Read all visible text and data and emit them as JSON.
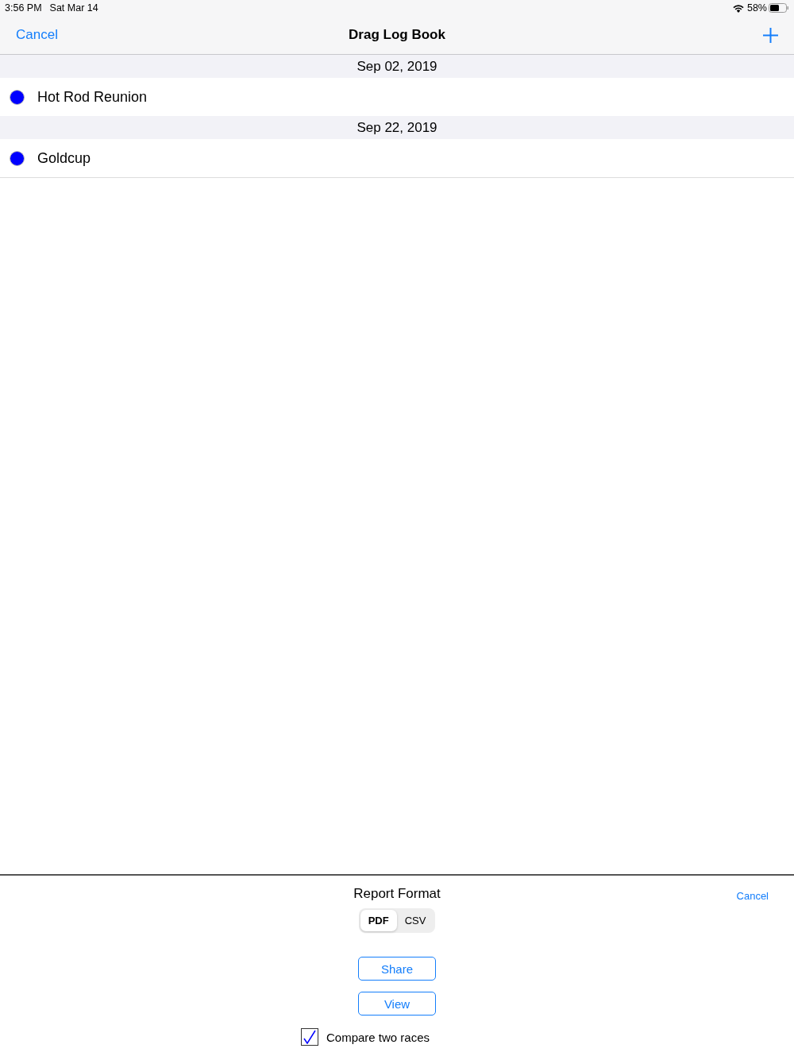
{
  "status_bar": {
    "time": "3:56 PM",
    "date": "Sat Mar 14",
    "battery": "58%"
  },
  "nav": {
    "cancel": "Cancel",
    "title": "Drag Log Book"
  },
  "sections": [
    {
      "date": "Sep 02, 2019",
      "rows": [
        {
          "name": "Hot Rod Reunion",
          "color": "#0000ff"
        }
      ]
    },
    {
      "date": "Sep 22, 2019",
      "rows": [
        {
          "name": "Goldcup",
          "color": "#0000ff"
        }
      ]
    }
  ],
  "report": {
    "title": "Report Format",
    "cancel": "Cancel",
    "formats": [
      {
        "label": "PDF",
        "selected": true
      },
      {
        "label": "CSV",
        "selected": false
      }
    ],
    "buttons": [
      "Share",
      "View"
    ],
    "compare": {
      "label": "Compare two races",
      "checked": true
    }
  }
}
